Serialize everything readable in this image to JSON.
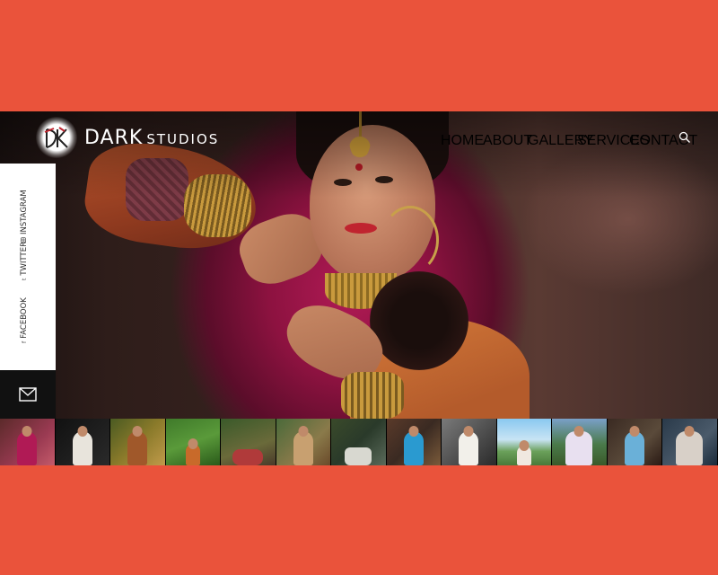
{
  "brand": {
    "name_main": "DARK",
    "name_sub": "STUDIOS",
    "logo_mark": "DK"
  },
  "nav": {
    "items": [
      {
        "label": "HOME"
      },
      {
        "label": "ABOUT"
      },
      {
        "label": "GALLERY"
      },
      {
        "label": "SERVICES"
      },
      {
        "label": "CONTACT"
      }
    ],
    "search_icon": "search-icon"
  },
  "social": {
    "items": [
      {
        "label": "FACEBOOK",
        "icon": "f"
      },
      {
        "label": "TWITTER",
        "icon": "t"
      },
      {
        "label": "INSTAGRAM",
        "icon": "instagram-icon"
      }
    ],
    "mail_icon": "envelope-icon"
  },
  "gallery_strip": {
    "thumbnails": [
      {
        "alt": "bride in pink"
      },
      {
        "alt": "groom in white"
      },
      {
        "alt": "woman in forest"
      },
      {
        "alt": "couple in field"
      },
      {
        "alt": "woman on rocks"
      },
      {
        "alt": "traditional groom"
      },
      {
        "alt": "wedding car"
      },
      {
        "alt": "woman in blue"
      },
      {
        "alt": "bride in white"
      },
      {
        "alt": "woman by lake"
      },
      {
        "alt": "couple under tree"
      },
      {
        "alt": "woman in blue dress"
      },
      {
        "alt": "couple portrait"
      }
    ]
  },
  "colors": {
    "page_background": "#ea533b",
    "sidebar_background": "#ffffff",
    "mail_button_background": "#111111",
    "nav_text": "#ffffff"
  }
}
